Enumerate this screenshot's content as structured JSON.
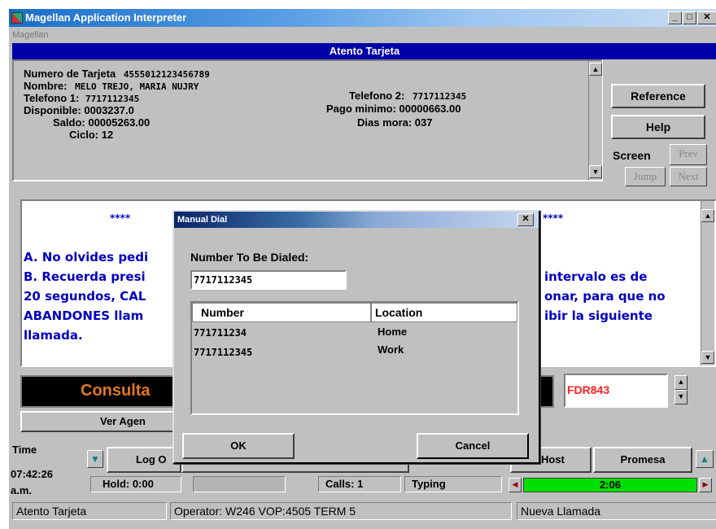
{
  "window": {
    "title": "Magellan Application Interpreter",
    "menu": "Magellan",
    "header": "Atento Tarjeta"
  },
  "account": {
    "card_label": "Numero de Tarjeta",
    "card_value": "4555012123456789",
    "name_label": "Nombre:",
    "name_value": "MELO TREJO, MARIA NUJRY",
    "phone1_label": "Telefono 1:",
    "phone1_value": "7717112345",
    "phone2_label": "Telefono 2:",
    "phone2_value": "7717112345",
    "available": "Disponible: 0003237.0",
    "min_payment": "Pago minimo: 00000663.00",
    "balance": "Saldo: 00005263.00",
    "days_late": "Dias mora: 037",
    "cycle": "Ciclo: 12"
  },
  "side_buttons": {
    "reference": "Reference",
    "help": "Help",
    "screen": "Screen",
    "prev": "Prev",
    "jump": "Jump",
    "next": "Next"
  },
  "script": {
    "stars_left": "****",
    "stars_right": "****",
    "line_a": "A. No olvides pedi",
    "line_b_left": "B. Recuerda presi",
    "line_b_right": "intervalo es de",
    "line_c_left": "20 segundos, CAL",
    "line_c_right": "onar, para que no",
    "line_d_left": "ABANDONES llam",
    "line_d_right": "ibir la siguiente",
    "line_e": "llamada."
  },
  "consulta": "Consulta",
  "code": "FDR843",
  "ver_agenda": "Ver Agen",
  "toolbar": {
    "time_label": "Time",
    "time_value": "07:42:26",
    "ampm": "a.m.",
    "logout": "Log O",
    "host": "Host",
    "promesa": "Promesa",
    "hold": "Hold: 0:00",
    "calls": "Calls: 1",
    "typing": "Typing",
    "timer": "2:06"
  },
  "status": {
    "app": "Atento Tarjeta",
    "operator": "Operator: W246   VOP:4505   TERM 5",
    "state": "Nueva Llamada"
  },
  "dialog": {
    "title": "Manual Dial",
    "number_label": "Number To Be Dialed:",
    "number_value": "7717112345",
    "col_number": "Number",
    "col_location": "Location",
    "rows": [
      {
        "number": "771711234",
        "location": "Home"
      },
      {
        "number": "7717112345",
        "location": "Work"
      }
    ],
    "ok": "OK",
    "cancel": "Cancel"
  },
  "colors": {
    "header_blue": "#0000a8",
    "script_text": "#0000c0",
    "consulta_orange": "#e07820",
    "code_red": "#ff2020",
    "timer_green": "#00e000"
  }
}
